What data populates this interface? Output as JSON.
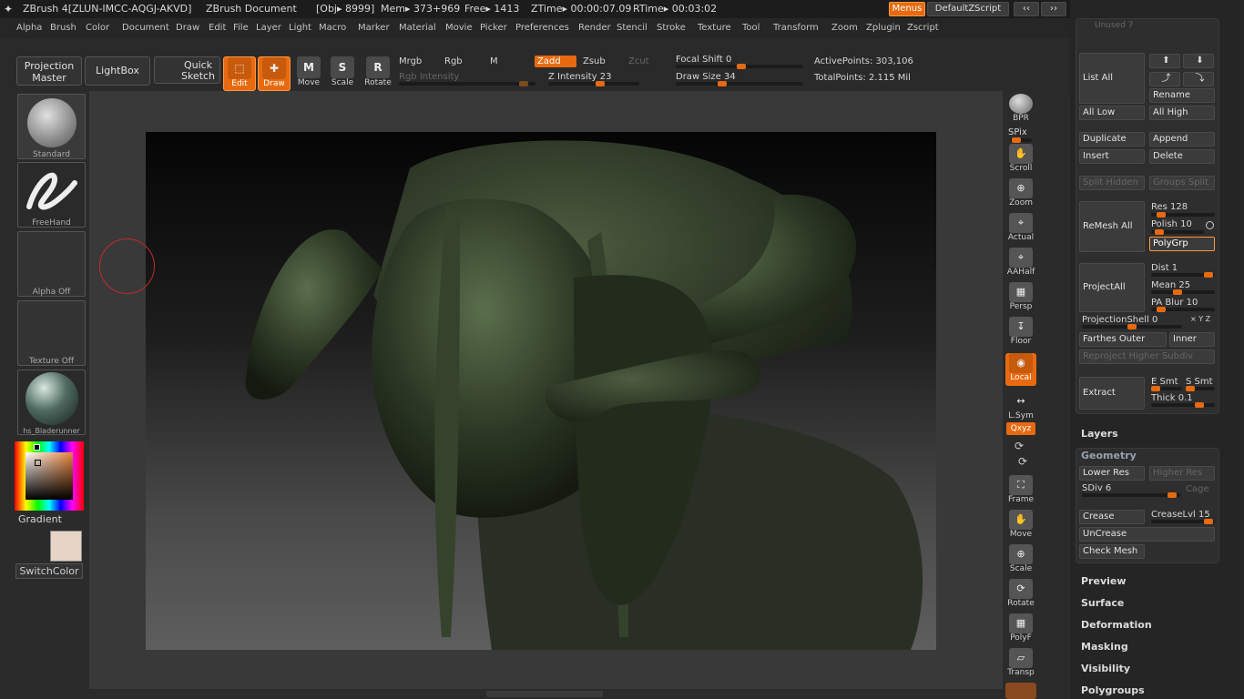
{
  "title": {
    "app": "ZBrush 4[ZLUN-IMCC-AQGJ-AKVD]",
    "doc": "ZBrush Document",
    "obj": "[Obj▸ 8999]",
    "mem": "Mem▸ 373+969",
    "free": "Free▸ 1413",
    "ztime": "ZTime▸ 00:00:07.09",
    "rtime": "RTime▸ 00:03:02",
    "menus_btn": "Menus",
    "script_btn": "DefaultZScript"
  },
  "menus": [
    "Alpha",
    "Brush",
    "Color",
    "Document",
    "Draw",
    "Edit",
    "File",
    "Layer",
    "Light",
    "Macro",
    "Marker",
    "Material",
    "Movie",
    "Picker",
    "Preferences",
    "Render",
    "Stencil",
    "Stroke",
    "Texture",
    "Tool",
    "Transform",
    "Zoom",
    "Zplugin",
    "Zscript"
  ],
  "shelf": {
    "projection_master": "Projection Master",
    "lightbox": "LightBox",
    "quick_sketch": "Quick Sketch",
    "edit": "Edit",
    "draw": "Draw",
    "move": "Move",
    "scale": "Scale",
    "rotate": "Rotate",
    "move_key": "M",
    "scale_key": "S",
    "rotate_key": "R",
    "mrgb": "Mrgb",
    "rgb": "Rgb",
    "m": "M",
    "zadd": "Zadd",
    "zsub": "Zsub",
    "zcut": "Zcut",
    "rgb_intensity": "Rgb Intensity",
    "z_intensity": "Z Intensity 23",
    "focal_shift": "Focal Shift 0",
    "draw_size": "Draw Size 34",
    "active_points": "ActivePoints: 303,106",
    "total_points": "TotalPoints: 2.115 Mil"
  },
  "left": {
    "standard": "Standard",
    "freehand": "FreeHand",
    "alpha_off": "Alpha Off",
    "texture_off": "Texture Off",
    "material": "hs_Bladerunner",
    "gradient": "Gradient",
    "switch_color": "SwitchColor"
  },
  "right": {
    "bpr": "BPR",
    "spix": "SPix",
    "scroll": "Scroll",
    "zoom": "Zoom",
    "actual": "Actual",
    "aahalf": "AAHalf",
    "persp": "Persp",
    "floor": "Floor",
    "local": "Local",
    "lsym": "L.Sym",
    "xyz": "Qxyz",
    "frame": "Frame",
    "move": "Move",
    "scale": "Scale",
    "rotate": "Rotate",
    "polyf": "PolyF",
    "transp": "Transp"
  },
  "tray": {
    "unused": "Unused 7",
    "list_all": "List All",
    "rename": "Rename",
    "all_low": "All Low",
    "all_high": "All High",
    "duplicate": "Duplicate",
    "append": "Append",
    "insert": "Insert",
    "delete": "Delete",
    "split_hidden": "Split Hidden",
    "groups_split": "Groups Split",
    "remesh_all": "ReMesh All",
    "res": "Res 128",
    "polish": "Polish 10",
    "polygrp": "PolyGrp",
    "project_all": "ProjectAll",
    "dist": "Dist 1",
    "mean": "Mean 25",
    "pa_blur": "PA Blur 10",
    "projection_shell": "ProjectionShell 0",
    "axes": "× Y Z",
    "farthest": "Farthes Outer",
    "inner": "Inner",
    "reproject": "Reproject Higher Subdiv",
    "extract": "Extract",
    "e_smt": "E Smt",
    "s_smt": "S Smt",
    "thick": "Thick 0.1",
    "layers": "Layers",
    "geometry": "Geometry",
    "lower_res": "Lower Res",
    "higher_res": "Higher Res",
    "sdiv": "SDiv 6",
    "cage": "Cage",
    "crease": "Crease",
    "crease_lvl": "CreaseLvl 15",
    "uncrease": "UnCrease",
    "check_mesh": "Check Mesh",
    "preview": "Preview",
    "surface": "Surface",
    "deformation": "Deformation",
    "masking": "Masking",
    "visibility": "Visibility",
    "polygroups": "Polygroups"
  },
  "colors": {
    "accent": "#e86a10",
    "bg": "#2b2b2b",
    "model": "#3b4a32"
  }
}
